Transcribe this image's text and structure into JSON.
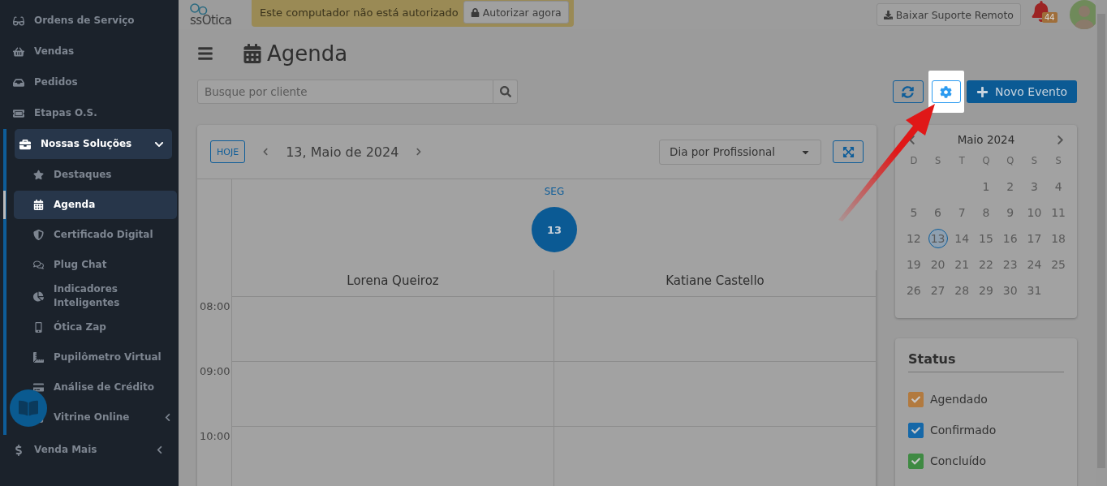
{
  "sidebar": {
    "items": [
      {
        "label": "Ordens de Serviço",
        "selected": false
      },
      {
        "label": "Vendas",
        "selected": false
      },
      {
        "label": "Pedidos",
        "selected": false
      },
      {
        "label": "Etapas O.S.",
        "selected": false
      },
      {
        "label": "Nossas Soluções",
        "selected": true,
        "expanded": true,
        "children": [
          {
            "label": "Destaques",
            "selected": false
          },
          {
            "label": "Agenda",
            "selected": true
          },
          {
            "label": "Certificado Digital",
            "selected": false
          },
          {
            "label": "Plug Chat",
            "selected": false
          },
          {
            "label": "Indicadores Inteligentes",
            "selected": false
          },
          {
            "label": "Ótica Zap",
            "selected": false
          },
          {
            "label": "Pupilômetro Virtual",
            "selected": false
          },
          {
            "label": "Análise de Crédito",
            "selected": false
          },
          {
            "label": "Vitrine Online",
            "selected": false,
            "expanded": false
          }
        ]
      },
      {
        "label": "Venda Mais",
        "selected": false,
        "expanded": false
      }
    ]
  },
  "header": {
    "logo": "ssOtica",
    "alert": "Este computador não está autorizado",
    "authorize_button": "Autorizar agora",
    "support_button": "Baixar Suporte Remoto",
    "notifications": "44"
  },
  "page": {
    "title": "Agenda",
    "search": {
      "placeholder": "Busque por cliente"
    },
    "new_event_button": "Novo Evento"
  },
  "calendar": {
    "today_button": "HOJE",
    "date": "13, Maio de 2024",
    "view_select": "Dia por Profissional",
    "weekday": "SEG",
    "day": "13",
    "columns": [
      "Lorena Queiroz",
      "Katiane Castello"
    ],
    "times": [
      "08:00",
      "09:00",
      "10:00"
    ]
  },
  "mini_calendar": {
    "month": "Maio 2024",
    "weekdays": [
      "D",
      "S",
      "T",
      "Q",
      "Q",
      "S",
      "S"
    ],
    "weeks": [
      [
        {
          "label": "1",
          "selected": false
        },
        {
          "label": "2",
          "selected": false
        },
        {
          "label": "3",
          "selected": false
        },
        {
          "label": "4",
          "selected": false
        }
      ],
      [
        {
          "label": "5",
          "selected": false
        },
        {
          "label": "6",
          "selected": false
        },
        {
          "label": "7",
          "selected": false
        },
        {
          "label": "8",
          "selected": false
        },
        {
          "label": "9",
          "selected": false
        },
        {
          "label": "10",
          "selected": false
        },
        {
          "label": "11",
          "selected": false
        }
      ],
      [
        {
          "label": "12",
          "selected": false
        },
        {
          "label": "13",
          "selected": true
        },
        {
          "label": "14",
          "selected": false
        },
        {
          "label": "15",
          "selected": false
        },
        {
          "label": "16",
          "selected": false
        },
        {
          "label": "17",
          "selected": false
        },
        {
          "label": "18",
          "selected": false
        }
      ],
      [
        {
          "label": "19",
          "selected": false
        },
        {
          "label": "20",
          "selected": false
        },
        {
          "label": "21",
          "selected": false
        },
        {
          "label": "22",
          "selected": false
        },
        {
          "label": "23",
          "selected": false
        },
        {
          "label": "24",
          "selected": false
        },
        {
          "label": "25",
          "selected": false
        }
      ],
      [
        {
          "label": "26",
          "selected": false
        },
        {
          "label": "27",
          "selected": false
        },
        {
          "label": "28",
          "selected": false
        },
        {
          "label": "29",
          "selected": false
        },
        {
          "label": "30",
          "selected": false
        },
        {
          "label": "31",
          "selected": false
        }
      ]
    ]
  },
  "status": {
    "title": "Status",
    "items": [
      {
        "label": "Agendado",
        "checked": true,
        "color": "#b27a3f"
      },
      {
        "label": "Confirmado",
        "checked": true,
        "color": "#1668a8"
      },
      {
        "label": "Concluído",
        "checked": true,
        "color": "#3f8a43"
      }
    ]
  }
}
